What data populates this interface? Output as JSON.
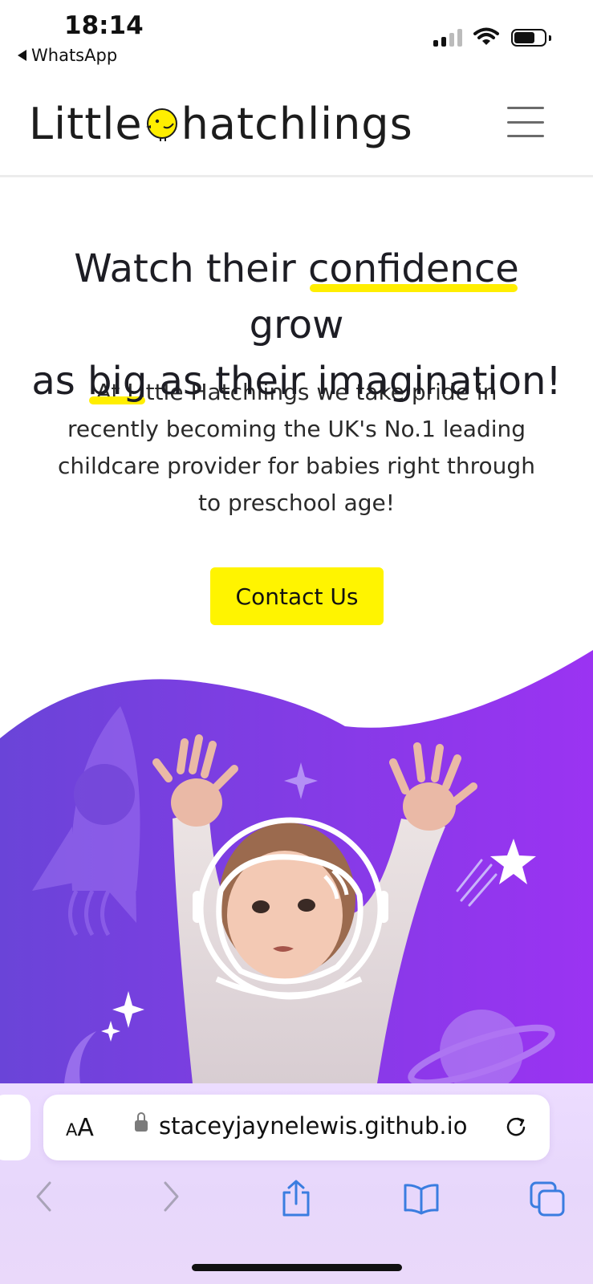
{
  "status_bar": {
    "time": "18:14",
    "back_label": "WhatsApp"
  },
  "header": {
    "logo_text_left": "Little",
    "logo_text_right": "hatchlings",
    "menu_icon": "hamburger-menu-icon"
  },
  "hero": {
    "headline_line1_a": "Watch their ",
    "headline_line1_highlight": "confidence",
    "headline_line1_b": " grow",
    "headline_line2_a": "as ",
    "headline_line2_highlight": "big",
    "headline_line2_b": " as their imagination!",
    "intro": "At Little Hatchlings we take pride in recently becoming the UK's No.1 leading childcare provider for babies right through to preschool age!",
    "cta_label": "Contact Us"
  },
  "browser": {
    "text_size_label": "AA",
    "url": "staceyjaynelewis.github.io"
  },
  "colors": {
    "accent_yellow": "#fff400",
    "banner_purple_start": "#6e3fe0",
    "banner_purple_end": "#9b35f0"
  }
}
